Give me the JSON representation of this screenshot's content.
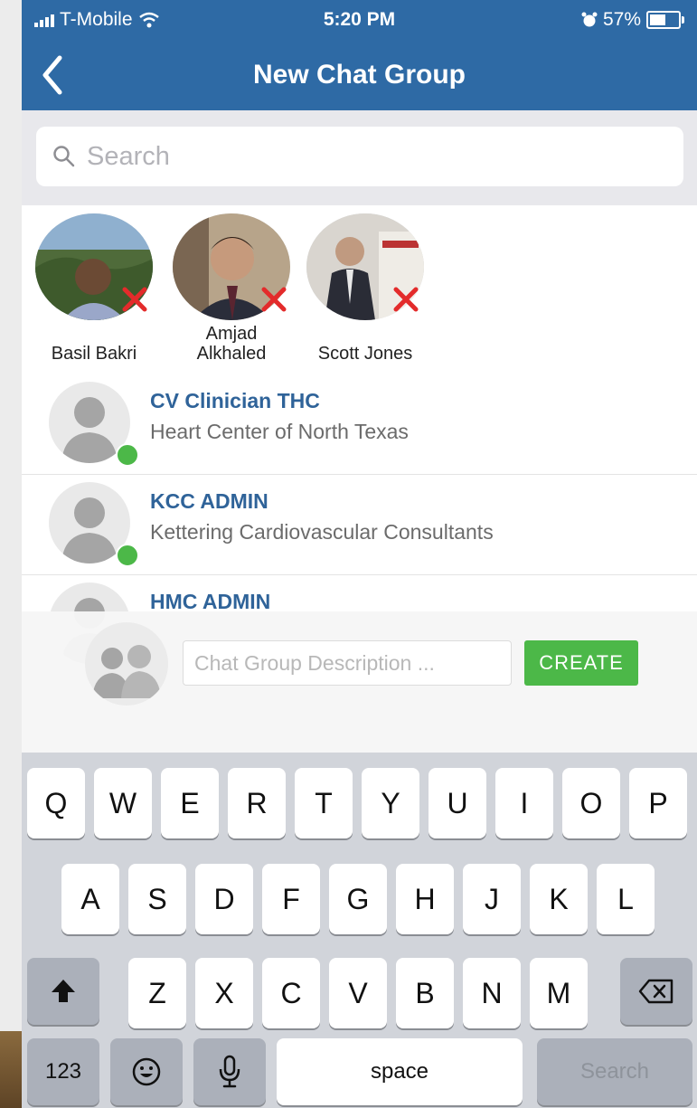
{
  "status_bar": {
    "carrier": "T-Mobile",
    "time": "5:20 PM",
    "battery": "57%"
  },
  "nav": {
    "title": "New Chat Group",
    "back_icon": "chevron-left-icon"
  },
  "search": {
    "placeholder": "Search"
  },
  "selected_members": [
    {
      "name": "Basil Bakri"
    },
    {
      "name": "Amjad Alkhaled"
    },
    {
      "name": "Scott Jones"
    }
  ],
  "contacts": [
    {
      "name": "CV Clinician THC",
      "org": "Heart Center of North Texas",
      "online": true
    },
    {
      "name": "KCC ADMIN",
      "org": "Kettering Cardiovascular Consultants",
      "online": true
    },
    {
      "name": "HMC ADMIN",
      "org": "",
      "online": false
    }
  ],
  "create_group": {
    "description_placeholder": "Chat Group Description ...",
    "create_label": "CREATE"
  },
  "keyboard": {
    "row1": [
      "Q",
      "W",
      "E",
      "R",
      "T",
      "Y",
      "U",
      "I",
      "O",
      "P"
    ],
    "row2": [
      "A",
      "S",
      "D",
      "F",
      "G",
      "H",
      "J",
      "K",
      "L"
    ],
    "row3": [
      "Z",
      "X",
      "C",
      "V",
      "B",
      "N",
      "M"
    ],
    "numbers_label": "123",
    "space_label": "space",
    "search_label": "Search"
  },
  "colors": {
    "nav_blue": "#2e6aa5",
    "accent_green": "#4cb848",
    "name_blue": "#2f6399",
    "remove_red": "#e32b2b"
  }
}
